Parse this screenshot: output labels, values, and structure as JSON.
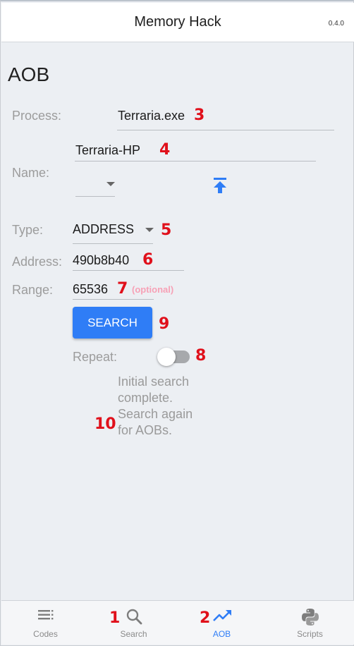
{
  "app": {
    "title": "Memory Hack",
    "version": "0.4.0"
  },
  "page": {
    "title": "AOB"
  },
  "form": {
    "process_label": "Process:",
    "process_value": "Terraria.exe",
    "name_label": "Name:",
    "name_value": "Terraria-HP",
    "type_label": "Type:",
    "type_value": "ADDRESS",
    "address_label": "Address:",
    "address_value": "490b8b40",
    "range_label": "Range:",
    "range_value": "65536",
    "range_hint": "(optional)",
    "search_label": "SEARCH",
    "repeat_label": "Repeat:",
    "repeat_on": false,
    "status_text": "Initial search complete. Search again for AOBs."
  },
  "annotations": {
    "n1": "1",
    "n2": "2",
    "n3": "3",
    "n4": "4",
    "n5": "5",
    "n6": "6",
    "n7": "7",
    "n8": "8",
    "n9": "9",
    "n10": "10"
  },
  "nav": {
    "items": [
      {
        "label": "Codes",
        "icon": "list-icon"
      },
      {
        "label": "Search",
        "icon": "search-icon"
      },
      {
        "label": "AOB",
        "icon": "trending-up-icon"
      },
      {
        "label": "Scripts",
        "icon": "python-icon"
      }
    ],
    "active": "AOB"
  },
  "colors": {
    "accent": "#2f7df6",
    "annotation": "#e0101b",
    "hint": "#f7a1b6",
    "background": "#eceff3"
  }
}
